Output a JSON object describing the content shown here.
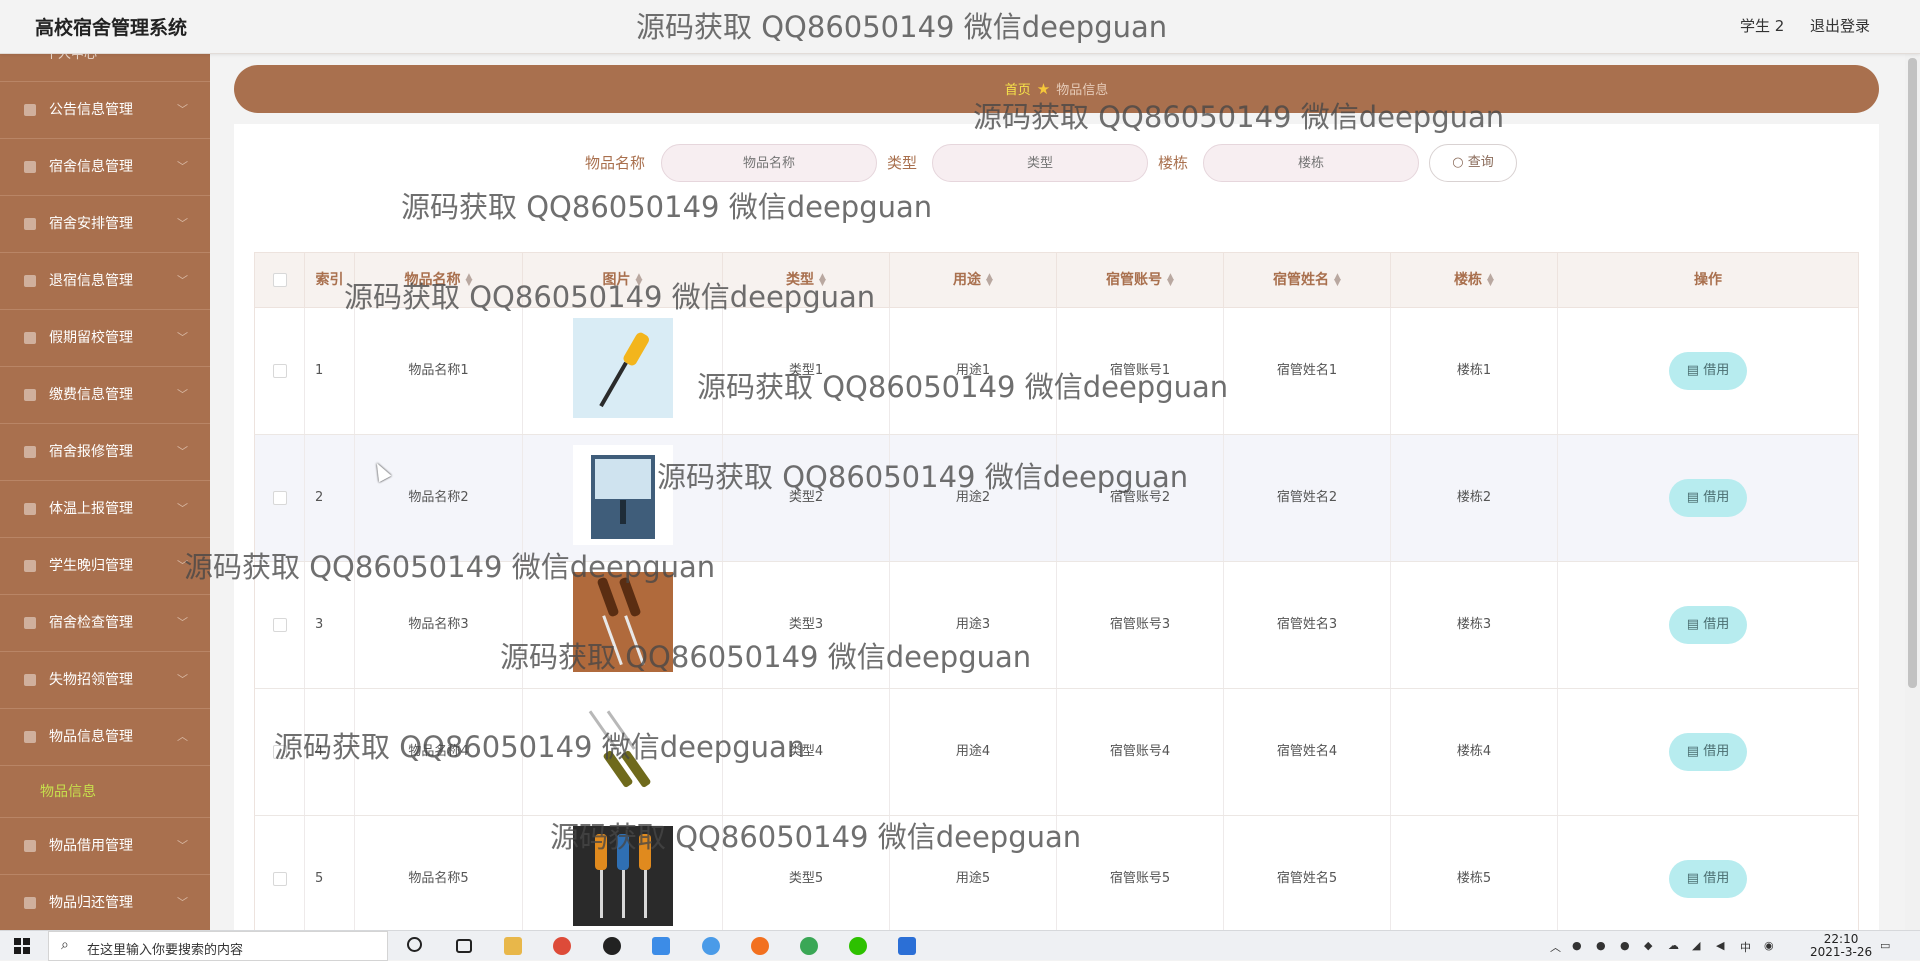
{
  "app": {
    "title": "高校宿舍管理系统",
    "user": "学生 2",
    "logout": "退出登录"
  },
  "sidebar": {
    "partial_label": "个人中心",
    "items": [
      {
        "label": "公告信息管理"
      },
      {
        "label": "宿舍信息管理"
      },
      {
        "label": "宿舍安排管理"
      },
      {
        "label": "退宿信息管理"
      },
      {
        "label": "假期留校管理"
      },
      {
        "label": "缴费信息管理"
      },
      {
        "label": "宿舍报修管理"
      },
      {
        "label": "体温上报管理"
      },
      {
        "label": "学生晚归管理"
      },
      {
        "label": "宿舍检查管理"
      },
      {
        "label": "失物招领管理"
      },
      {
        "label": "物品信息管理"
      }
    ],
    "active_sub": "物品信息",
    "items_after": [
      {
        "label": "物品借用管理"
      },
      {
        "label": "物品归还管理"
      }
    ]
  },
  "breadcrumb": {
    "home": "首页",
    "current": "物品信息"
  },
  "search": {
    "name_label": "物品名称",
    "name_placeholder": "物品名称",
    "type_label": "类型",
    "type_placeholder": "类型",
    "building_label": "楼栋",
    "building_placeholder": "楼栋",
    "button": "查询"
  },
  "table": {
    "headers": [
      "索引",
      "物品名称",
      "图片",
      "类型",
      "用途",
      "宿管账号",
      "宿管姓名",
      "楼栋",
      "操作"
    ],
    "rows": [
      {
        "index": "1",
        "name": "物品名称1",
        "type": "类型1",
        "use": "用途1",
        "account": "宿管账号1",
        "manager": "宿管姓名1",
        "building": "楼栋1",
        "action": "借用"
      },
      {
        "index": "2",
        "name": "物品名称2",
        "type": "类型2",
        "use": "用途2",
        "account": "宿管账号2",
        "manager": "宿管姓名2",
        "building": "楼栋2",
        "action": "借用"
      },
      {
        "index": "3",
        "name": "物品名称3",
        "type": "类型3",
        "use": "用途3",
        "account": "宿管账号3",
        "manager": "宿管姓名3",
        "building": "楼栋3",
        "action": "借用"
      },
      {
        "index": "4",
        "name": "物品名称4",
        "type": "类型4",
        "use": "用途4",
        "account": "宿管账号4",
        "manager": "宿管姓名4",
        "building": "楼栋4",
        "action": "借用"
      },
      {
        "index": "5",
        "name": "物品名称5",
        "type": "类型5",
        "use": "用途5",
        "account": "宿管账号5",
        "manager": "宿管姓名5",
        "building": "楼栋5",
        "action": "借用"
      }
    ]
  },
  "watermark": "源码获取 QQ86050149 微信deepguan",
  "taskbar": {
    "search_placeholder": "在这里输入你要搜索的内容",
    "time": "22:10",
    "date": "2021-3-26"
  },
  "colors": {
    "accent": "#a9704e",
    "button": "#b7ecef",
    "highlight": "#c7e04d"
  }
}
